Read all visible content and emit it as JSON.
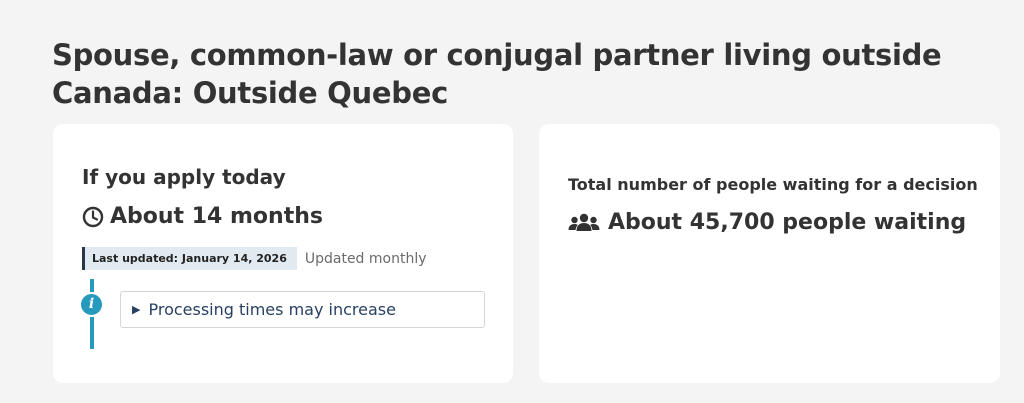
{
  "page": {
    "title": "Spouse, common-law or conjugal partner living outside Canada: Outside Quebec"
  },
  "apply_card": {
    "heading": "If you apply today",
    "time_icon": "clock-icon",
    "time": "About 14 months",
    "last_updated": "Last updated: January 14, 2026",
    "update_frequency": "Updated monthly",
    "info_icon": "info-icon",
    "details_marker": "▶",
    "details_label": "Processing times may increase"
  },
  "waiting_card": {
    "heading": "Total number of people waiting for a decision",
    "people_icon": "users-icon",
    "count": "About 45,700 people waiting"
  },
  "colors": {
    "background": "#f4f4f4",
    "card": "#ffffff",
    "text": "#333333",
    "info_accent": "#269abc",
    "badge_bg": "#e1eaf0",
    "badge_border": "#26374a",
    "link": "#284162"
  }
}
